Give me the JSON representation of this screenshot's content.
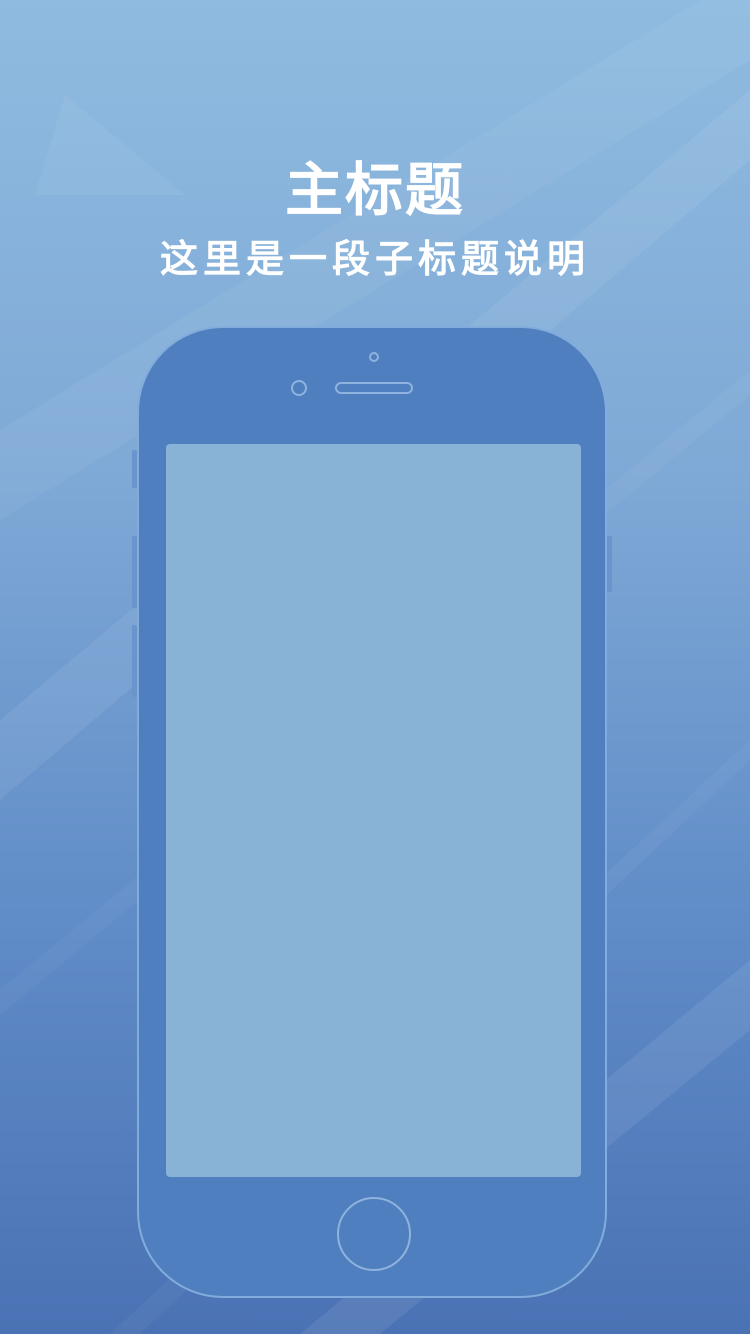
{
  "header": {
    "title": "主标题",
    "subtitle": "这里是一段子标题说明"
  },
  "colors": {
    "background_top": "#8fbbe0",
    "background_bottom": "#4a72b4",
    "phone_body": "#4f7fbe",
    "phone_outline": "#82acdc",
    "phone_screen": "#88b2d6",
    "text": "#ffffff"
  }
}
